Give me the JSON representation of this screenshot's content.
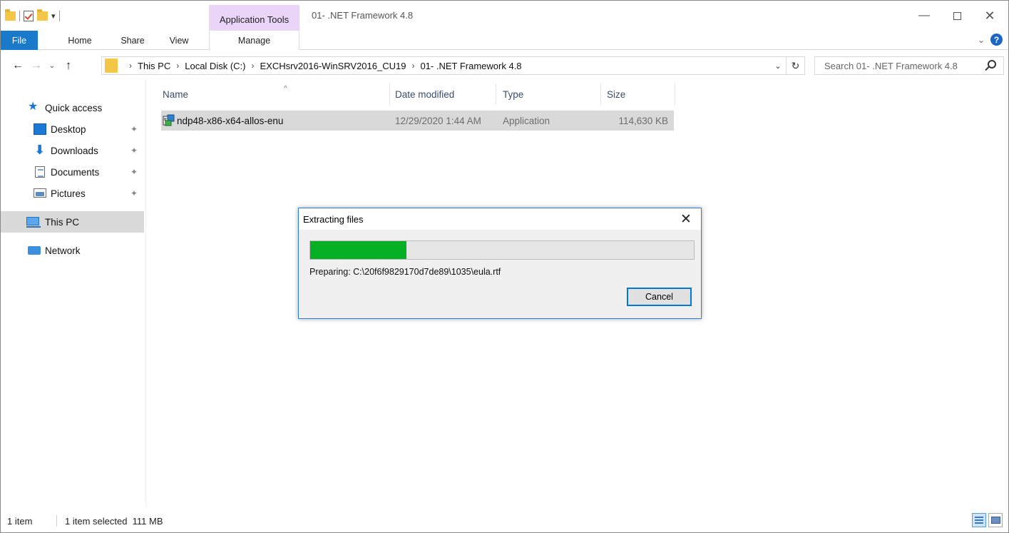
{
  "window": {
    "title": "01- .NET Framework 4.8",
    "context_tab_group": "Application Tools"
  },
  "ribbon": {
    "tabs": [
      "File",
      "Home",
      "Share",
      "View",
      "Manage"
    ]
  },
  "address": {
    "crumbs": [
      "This PC",
      "Local Disk (C:)",
      "EXCHsrv2016-WinSRV2016_CU19",
      "01- .NET Framework 4.8"
    ],
    "search_placeholder": "Search 01- .NET Framework 4.8"
  },
  "navpane": {
    "items": [
      {
        "label": "Quick access",
        "icon": "star-icon"
      },
      {
        "label": "Desktop",
        "icon": "desktop-icon",
        "pinned": true
      },
      {
        "label": "Downloads",
        "icon": "download-arrow-icon",
        "pinned": true
      },
      {
        "label": "Documents",
        "icon": "documents-icon",
        "pinned": true
      },
      {
        "label": "Pictures",
        "icon": "pictures-icon",
        "pinned": true
      },
      {
        "label": "This PC",
        "icon": "computer-icon",
        "selected": true
      },
      {
        "label": "Network",
        "icon": "network-icon"
      }
    ]
  },
  "list": {
    "columns": [
      "Name",
      "Date modified",
      "Type",
      "Size"
    ],
    "rows": [
      {
        "name": "ndp48-x86-x64-allos-enu",
        "date": "12/29/2020 1:44 AM",
        "type": "Application",
        "size": "114,630 KB",
        "selected": true
      }
    ]
  },
  "dialog": {
    "title": "Extracting files",
    "progress_fraction": 0.25,
    "status": "Preparing: C:\\20f6f9829170d7de89\\1035\\eula.rtf",
    "cancel_label": "Cancel"
  },
  "statusbar": {
    "count": "1 item",
    "selection": "1 item selected  111 MB"
  },
  "colors": {
    "file_tab": "#1979ca",
    "context_tab": "#ead4f7",
    "progress": "#06b025",
    "selection": "#d9d9d9"
  }
}
